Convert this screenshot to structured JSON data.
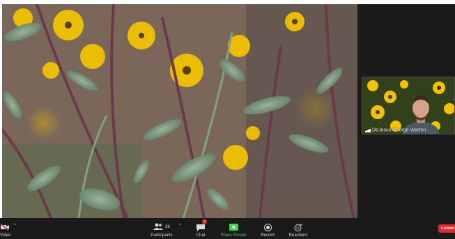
{
  "main_video": {
    "description": "plants"
  },
  "participant_tile": {
    "name": "DeJesus George-Warfen",
    "signal_icon": "signal-bars-icon"
  },
  "toolbar": {
    "video_label": "Video",
    "participants_label": "Participants",
    "participants_count": "36",
    "chat_label": "Chat",
    "chat_badge": "2",
    "share_label": "Share Screen",
    "record_label": "Record",
    "reactions_label": "Reactions",
    "leave_label": "Leave"
  },
  "colors": {
    "toolbar_bg": "#1a1a1a",
    "share_green": "#3ed34c",
    "leave_red": "#e02828",
    "badge_red": "#e02828"
  }
}
